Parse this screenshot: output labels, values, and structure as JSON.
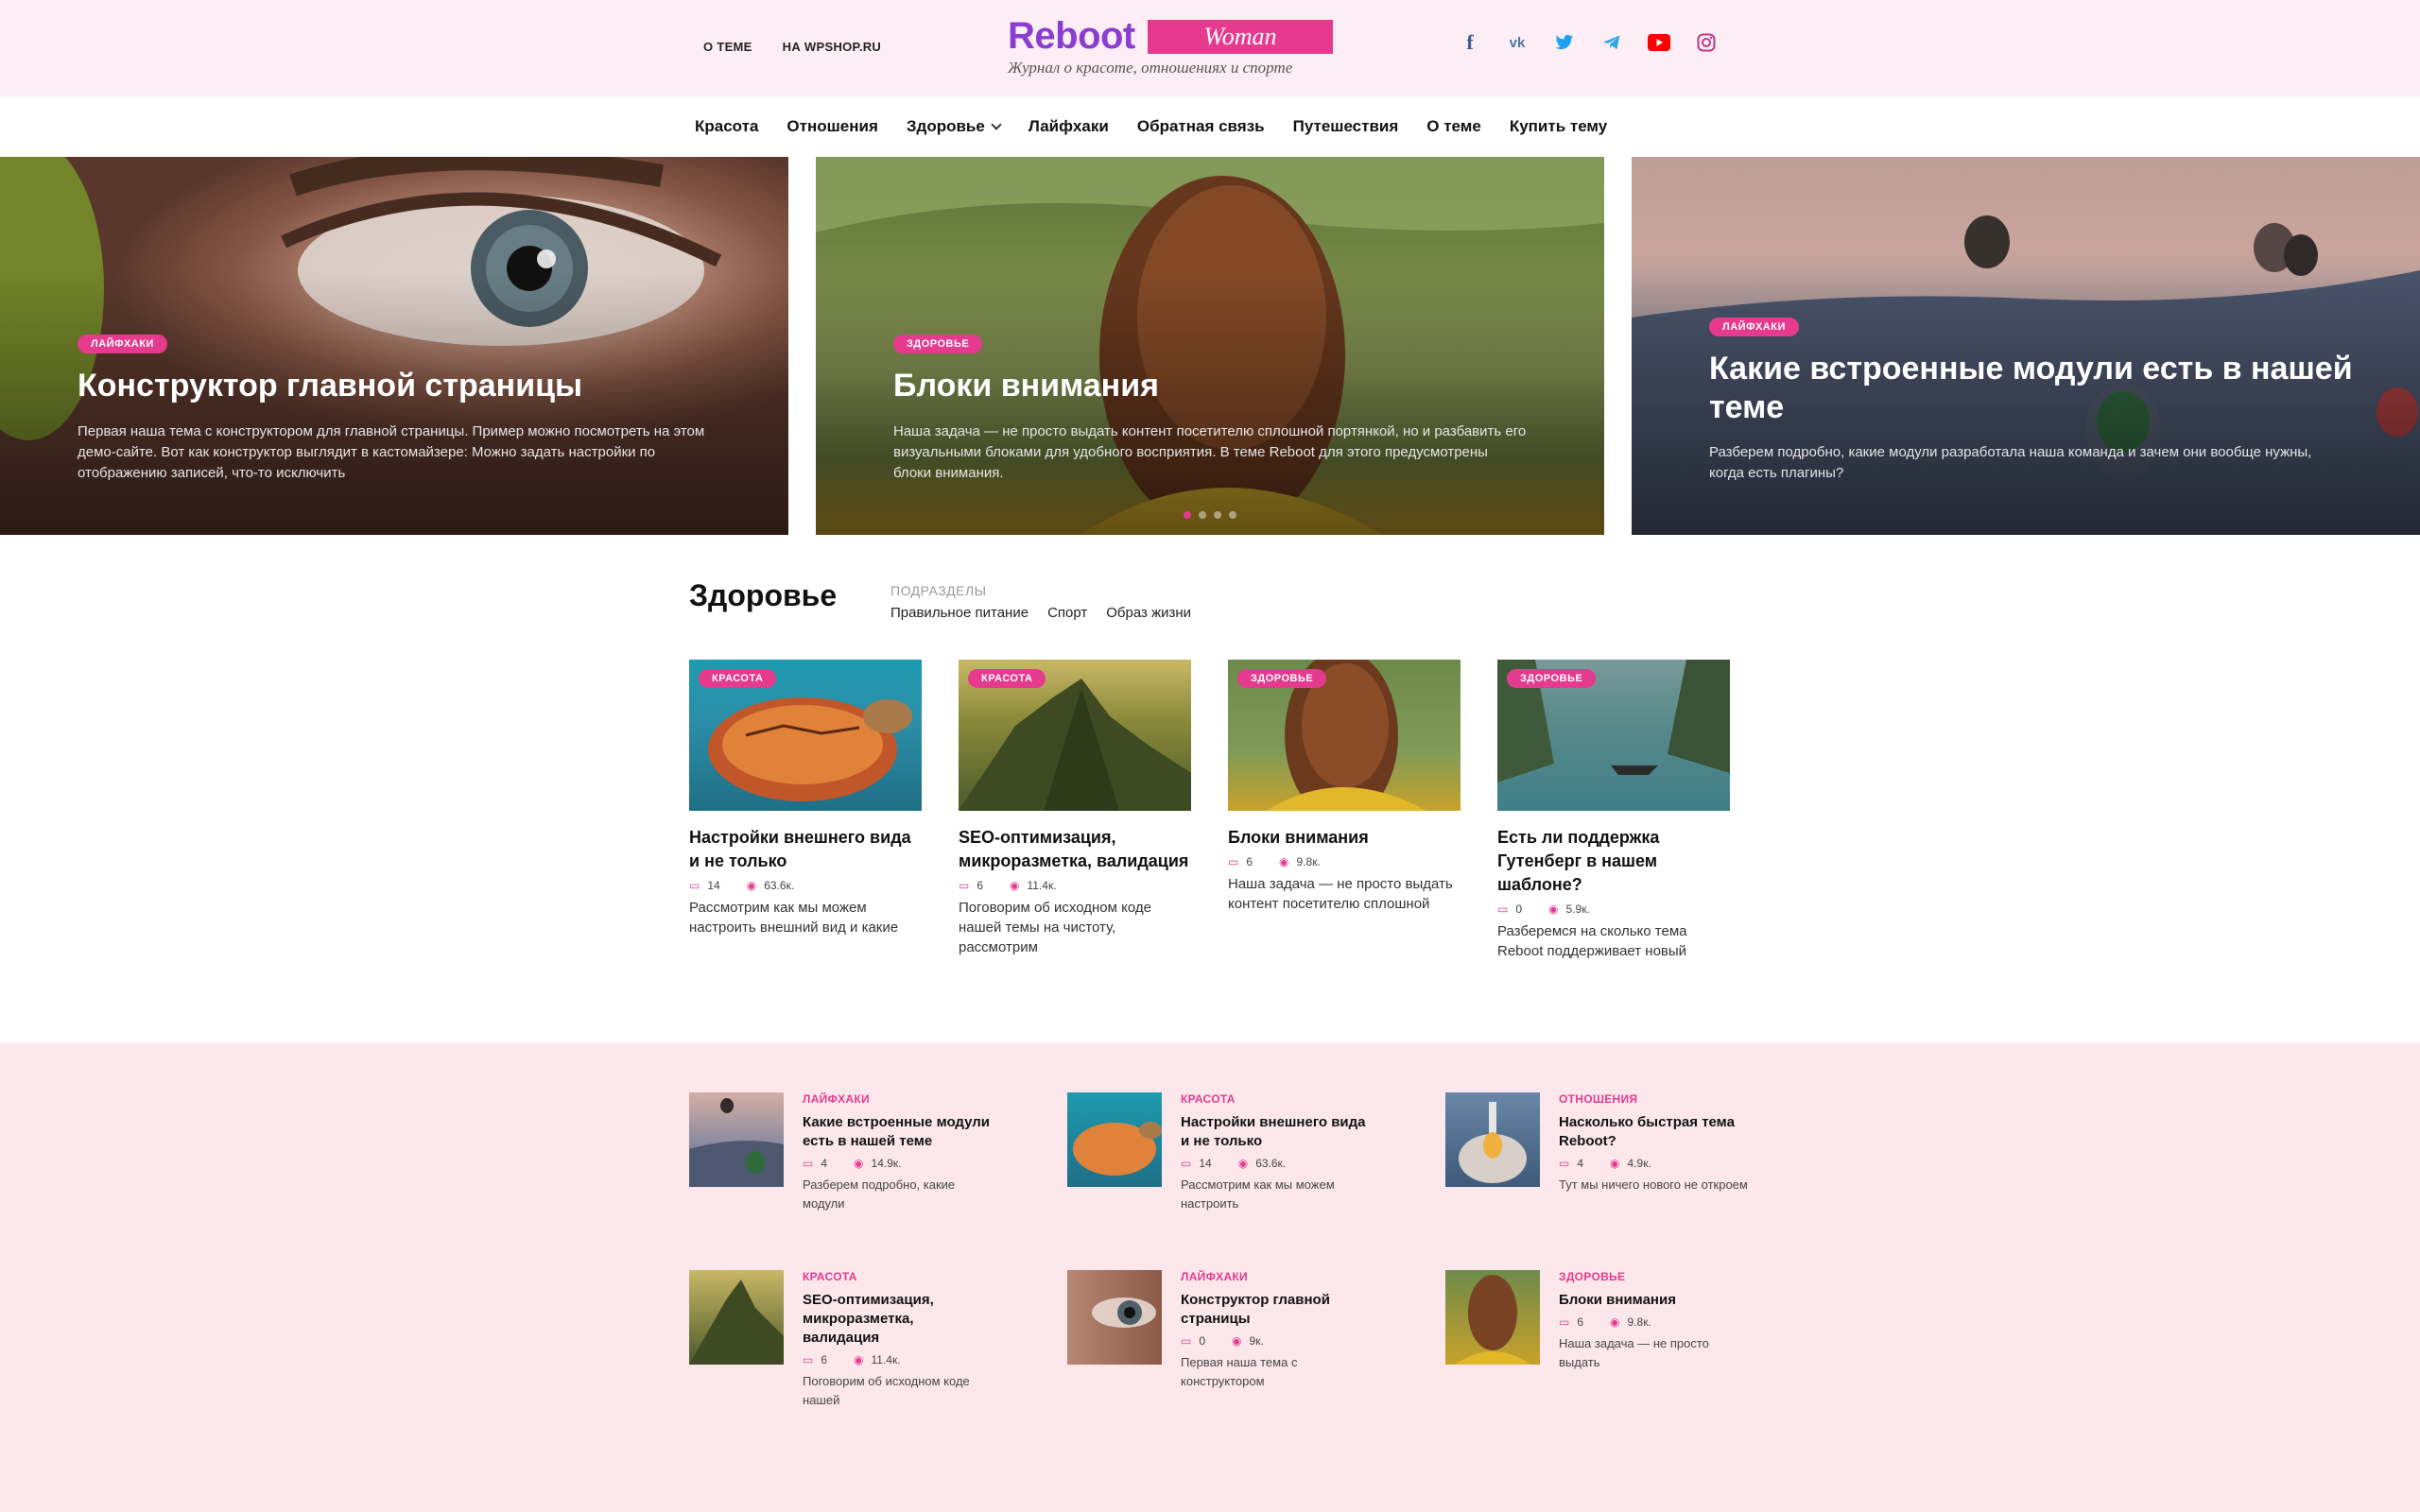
{
  "header": {
    "links": [
      "О ТЕМЕ",
      "НА WPSHOP.RU"
    ],
    "logo_word": "Reboot",
    "logo_badge": "Woman",
    "tagline": "Журнал о красоте, отношениях и спорте",
    "socials": [
      {
        "name": "facebook-icon",
        "glyph": "f",
        "color": "#3b5998"
      },
      {
        "name": "vk-icon",
        "glyph": "vk",
        "color": "#4c75a3"
      },
      {
        "name": "twitter-icon",
        "glyph": "✦",
        "color": "#1da1f2"
      },
      {
        "name": "telegram-icon",
        "glyph": "➤",
        "color": "#2ca5e0"
      },
      {
        "name": "youtube-icon",
        "glyph": "▶",
        "color": "#ff0000"
      },
      {
        "name": "instagram-icon",
        "glyph": "◎",
        "color": "#c13584"
      }
    ]
  },
  "nav": {
    "items": [
      "Красота",
      "Отношения",
      "Здоровье",
      "Лайфхаки",
      "Обратная связь",
      "Путешествия",
      "О теме",
      "Купить тему"
    ],
    "dropdown_index": 2
  },
  "hero": [
    {
      "tag": "ЛАЙФХАКИ",
      "title": "Конструктор главной страницы",
      "text": "Первая наша тема с конструктором для главной страницы. Пример можно посмотреть на этом демо-сайте. Вот как конструктор выглядит в кастомайзере: Можно задать настройки по отображению записей, что-то исключить"
    },
    {
      "tag": "ЗДОРОВЬЕ",
      "title": "Блоки внимания",
      "text": "Наша задача — не просто выдать контент посетителю сплошной портянкой, но и разбавить его визуальными блоками для удобного восприятия. В теме Reboot для этого предусмотрены блоки внимания."
    },
    {
      "tag": "ЛАЙФХАКИ",
      "title": "Какие встроенные модули есть в нашей теме",
      "text": "Разберем подробно, какие модули разработала наша команда и зачем они вообще нужны, когда есть плагины?"
    }
  ],
  "accent": "#e63a8e",
  "section": {
    "title": "Здоровье",
    "sub_label": "ПОДРАЗДЕЛЫ",
    "subs": [
      "Правильное питание",
      "Спорт",
      "Образ жизни"
    ],
    "cards": [
      {
        "tag": "КРАСОТА",
        "title": "Настройки внешнего вида и не только",
        "comments": "14",
        "views": "63.6к.",
        "text": "Рассмотрим как мы можем настроить внешний вид и какие"
      },
      {
        "tag": "КРАСОТА",
        "title": "SEO-оптимизация, микроразметка, валидация",
        "comments": "6",
        "views": "11.4к.",
        "text": "Поговорим об исходном коде нашей темы на чистоту, рассмотрим"
      },
      {
        "tag": "ЗДОРОВЬЕ",
        "title": "Блоки внимания",
        "comments": "6",
        "views": "9.8к.",
        "text": "Наша задача — не просто выдать контент посетителю сплошной"
      },
      {
        "tag": "ЗДОРОВЬЕ",
        "title": "Есть ли поддержка Гутенберг в нашем шаблоне?",
        "comments": "0",
        "views": "5.9к.",
        "text": "Разберемся на сколько тема Reboot поддерживает новый"
      }
    ]
  },
  "bottom": [
    {
      "cat": "ЛАЙФХАКИ",
      "title": "Какие встроенные модули есть в нашей теме",
      "comments": "4",
      "views": "14.9к.",
      "text": "Разберем подробно, какие модули"
    },
    {
      "cat": "КРАСОТА",
      "title": "Настройки внешнего вида и не только",
      "comments": "14",
      "views": "63.6к.",
      "text": "Рассмотрим как мы можем настроить"
    },
    {
      "cat": "ОТНОШЕНИЯ",
      "title": "Насколько быстрая тема Reboot?",
      "comments": "4",
      "views": "4.9к.",
      "text": "Тут мы ничего нового не откроем"
    },
    {
      "cat": "КРАСОТА",
      "title": "SEO-оптимизация, микроразметка, валидация",
      "comments": "6",
      "views": "11.4к.",
      "text": "Поговорим об исходном коде нашей"
    },
    {
      "cat": "ЛАЙФХАКИ",
      "title": "Конструктор главной страницы",
      "comments": "0",
      "views": "9к.",
      "text": "Первая наша тема с конструктором"
    },
    {
      "cat": "ЗДОРОВЬЕ",
      "title": "Блоки внимания",
      "comments": "6",
      "views": "9.8к.",
      "text": "Наша задача — не просто выдать"
    }
  ]
}
